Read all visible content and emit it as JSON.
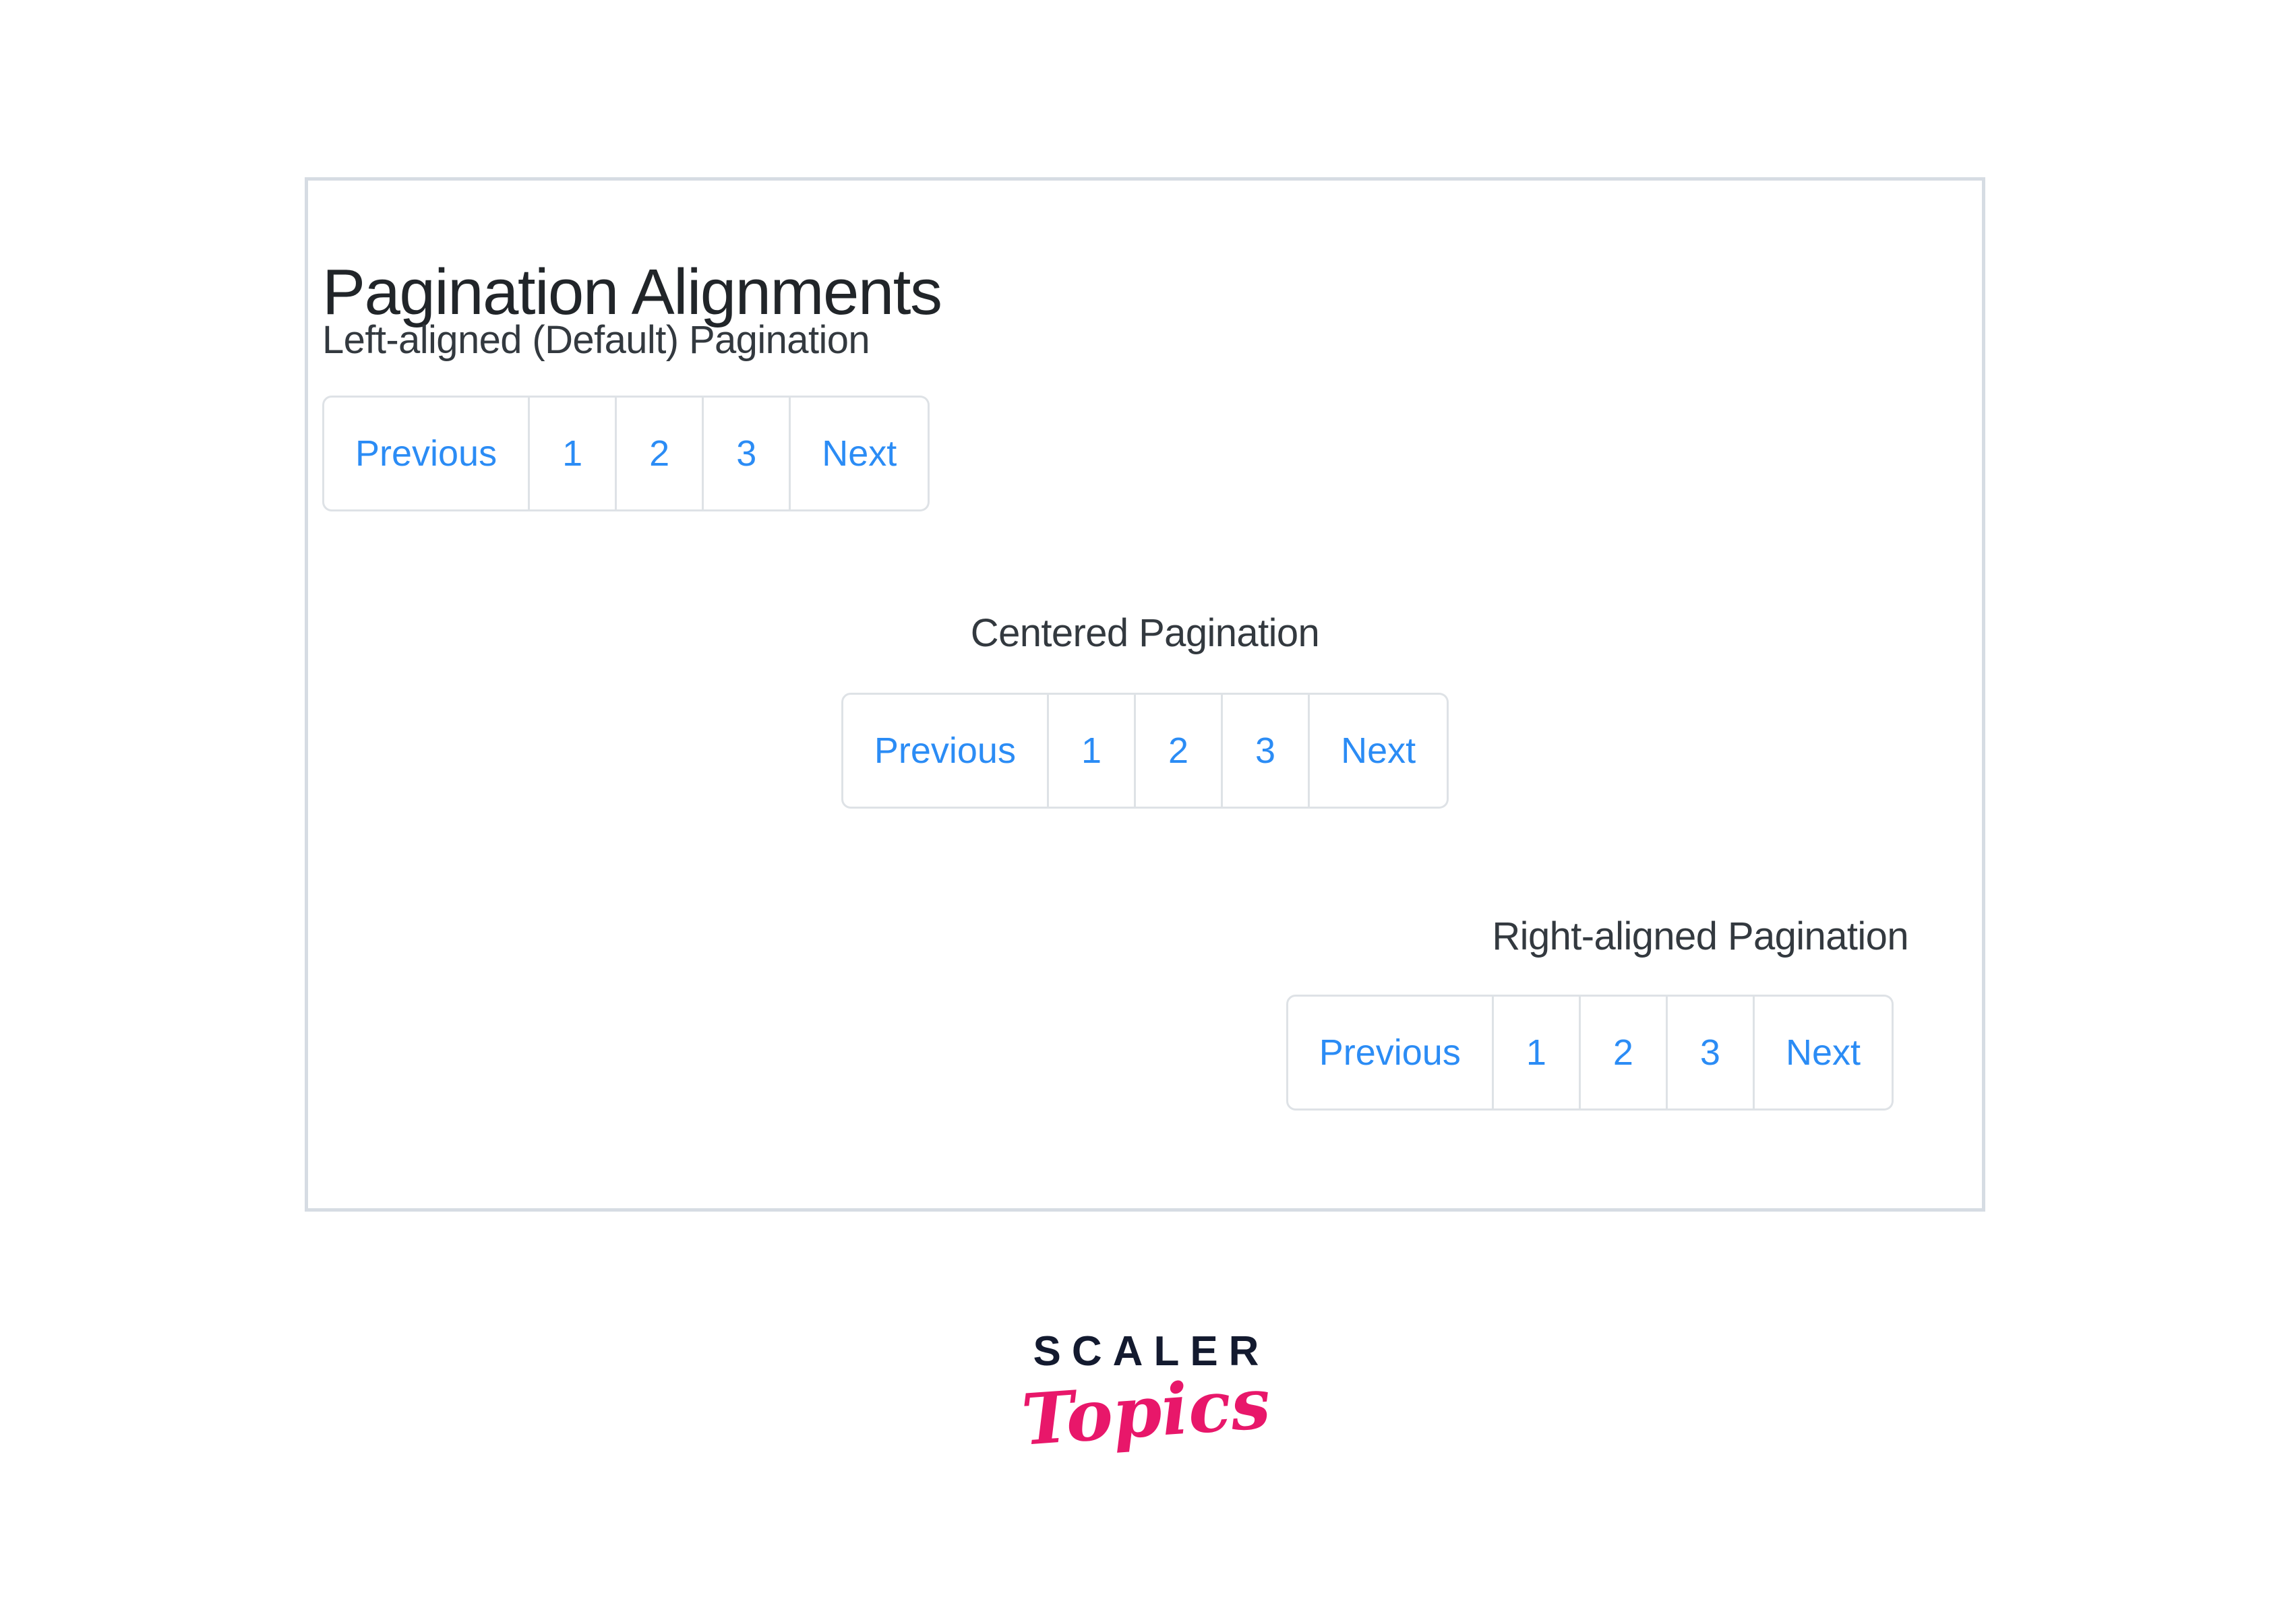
{
  "card": {
    "title": "Pagination Alignments",
    "border_color": "#d6dce3",
    "background": "#ffffff"
  },
  "theme": {
    "link_color": "#2b8cf5",
    "item_border_color": "#dee2e6",
    "heading_color": "#212529",
    "logo_dark": "#131a2f",
    "logo_pink": "#e8176a"
  },
  "sections": [
    {
      "id": "left",
      "heading": "Left-aligned (Default) Pagination",
      "alignment": "left",
      "pagination": {
        "previous_label": "Previous",
        "pages": [
          "1",
          "2",
          "3"
        ],
        "next_label": "Next"
      }
    },
    {
      "id": "center",
      "heading": "Centered Pagination",
      "alignment": "center",
      "pagination": {
        "previous_label": "Previous",
        "pages": [
          "1",
          "2",
          "3"
        ],
        "next_label": "Next"
      }
    },
    {
      "id": "right",
      "heading": "Right-aligned Pagination",
      "alignment": "right",
      "pagination": {
        "previous_label": "Previous",
        "pages": [
          "1",
          "2",
          "3"
        ],
        "next_label": "Next"
      }
    }
  ],
  "logo": {
    "brand": "SCALER",
    "sub": "Topics"
  }
}
